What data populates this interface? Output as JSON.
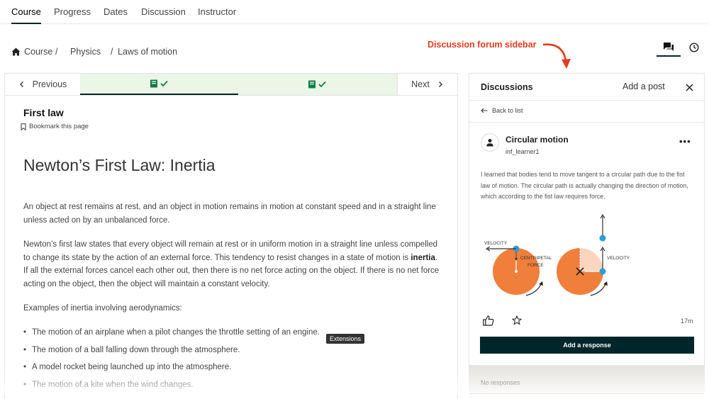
{
  "topnav": {
    "tabs": [
      {
        "label": "Course",
        "active": true
      },
      {
        "label": "Progress"
      },
      {
        "label": "Dates"
      },
      {
        "label": "Discussion"
      },
      {
        "label": "Instructor"
      }
    ]
  },
  "breadcrumb": {
    "home_icon": "home-icon",
    "items": [
      {
        "label": "Course",
        "sep": "/"
      },
      {
        "label": "Physics"
      },
      {
        "label": "Laws of motion",
        "sep": "/"
      }
    ]
  },
  "annotation": {
    "label": "Discussion forum sidebar",
    "color": "#e53b1c"
  },
  "sidebar_toggles": {
    "discussions_icon": "discussion-icon",
    "notifications_icon": "clock-icon"
  },
  "sequence_nav": {
    "previous_label": "Previous",
    "next_label": "Next",
    "units": [
      {
        "icon": "book-check-icon",
        "completed": true,
        "active": true
      },
      {
        "icon": "book-check-icon",
        "completed": true,
        "active": false
      }
    ],
    "completed_color": "#ebf6e6",
    "check_color": "#0d7d4d"
  },
  "unit": {
    "title": "First law",
    "bookmark_label": "Bookmark this page",
    "heading": "Newton’s First Law: Inertia",
    "para1": "An object at rest remains at rest, and an object in motion remains in motion at constant speed and in a straight line unless acted on by an unbalanced force.",
    "para2_part1": "Newton’s first law states that every object will remain at rest or in uniform motion in a straight line unless compelled to change its state by the action of an external force. This tendency to resist changes in a state of motion is ",
    "para2_bold": "inertia",
    "para2_part2": ". If all the external forces cancel each other out, then there is no net force acting on the object.  If there is no net force acting on the object, then the object will maintain a constant velocity.",
    "examples_intro": "Examples of inertia involving aerodynamics:",
    "examples": [
      "The motion of an airplane when a pilot changes the throttle setting of an engine.",
      "The motion of a ball falling down through the atmosphere.",
      "A model rocket being launched up into the atmosphere.",
      "The motion of a kite when the wind changes."
    ]
  },
  "tooltip": {
    "label": "Extensions"
  },
  "discussions": {
    "title": "Discussions",
    "add_post_label": "Add a post",
    "back_label": "Back to list",
    "post": {
      "title": "Circular motion",
      "author": "inf_learner1",
      "more_label": "•••",
      "body": "I learned that bodies tend to move tangent to a circular path due to the fist law of motion. The circular path is actually changing the direction of motion, which according to the fist law requires force.",
      "diagram": {
        "velocity_label_left": "VELOCITY",
        "centripetal_label_1": "CENTRIPETAL",
        "centripetal_label_2": "FORCE",
        "velocity_label_right": "VELOCITY",
        "ball_color": "#f07f3c",
        "dot_color": "#2a9fd6"
      },
      "time": "17m"
    },
    "add_response_label": "Add a response",
    "no_responses_label": "No responses",
    "button_color": "#00262b"
  }
}
